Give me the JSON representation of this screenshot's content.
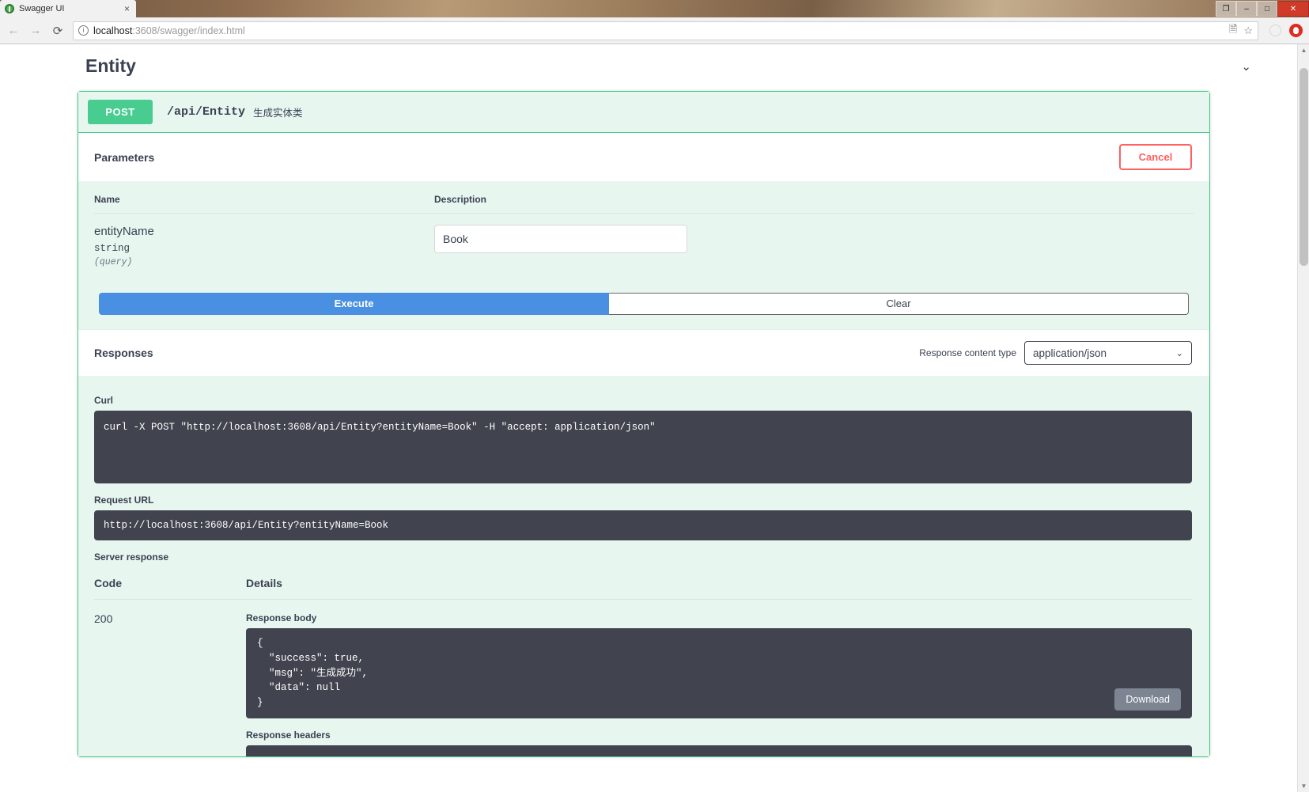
{
  "browser": {
    "tab": {
      "title": "Swagger UI",
      "favicon": "swagger-favicon",
      "close": "×"
    },
    "window_controls": {
      "minimize": "–",
      "maximize": "□",
      "close": "✕",
      "restore": "❐"
    },
    "nav": {
      "back": "←",
      "forward": "→",
      "reload": "⟳"
    },
    "omnibox": {
      "info_icon": "i",
      "url_host": "localhost",
      "url_rest": ":3608/swagger/index.html",
      "translate_icon": "translate-icon",
      "bookmark_icon": "☆"
    },
    "extensions": {
      "generic": "ext-circle-icon",
      "opera": "opera-icon"
    }
  },
  "tag": {
    "title": "Entity",
    "collapse_icon": "⌄"
  },
  "operation": {
    "method": "POST",
    "path": "/api/Entity",
    "summary": "生成实体类",
    "method_color": "#49cc90"
  },
  "parameters": {
    "section_title": "Parameters",
    "cancel_label": "Cancel",
    "columns": [
      "Name",
      "Description"
    ],
    "rows": [
      {
        "name": "entityName",
        "type": "string",
        "in": "(query)",
        "value": "Book",
        "placeholder": "entityName"
      }
    ]
  },
  "actions": {
    "execute_label": "Execute",
    "clear_label": "Clear"
  },
  "responses": {
    "section_title": "Responses",
    "content_type_label": "Response content type",
    "content_type_value": "application/json",
    "content_type_caret": "⌄",
    "curl_label": "Curl",
    "curl_value": "curl -X POST \"http://localhost:3608/api/Entity?entityName=Book\" -H \"accept: application/json\"",
    "request_url_label": "Request URL",
    "request_url_value": "http://localhost:3608/api/Entity?entityName=Book",
    "server_response_label": "Server response",
    "columns": [
      "Code",
      "Details"
    ],
    "code": "200",
    "response_body_label": "Response body",
    "response_body_value": "{\n  \"success\": true,\n  \"msg\": \"生成成功\",\n  \"data\": null\n}",
    "download_label": "Download",
    "response_headers_label": "Response headers"
  },
  "colors": {
    "accent_green": "#49cc90",
    "panel_bg": "#e8f6f0",
    "execute_blue": "#4990e2",
    "cancel_red": "#ff6060",
    "code_bg": "#41444e",
    "text": "#3b4151"
  }
}
